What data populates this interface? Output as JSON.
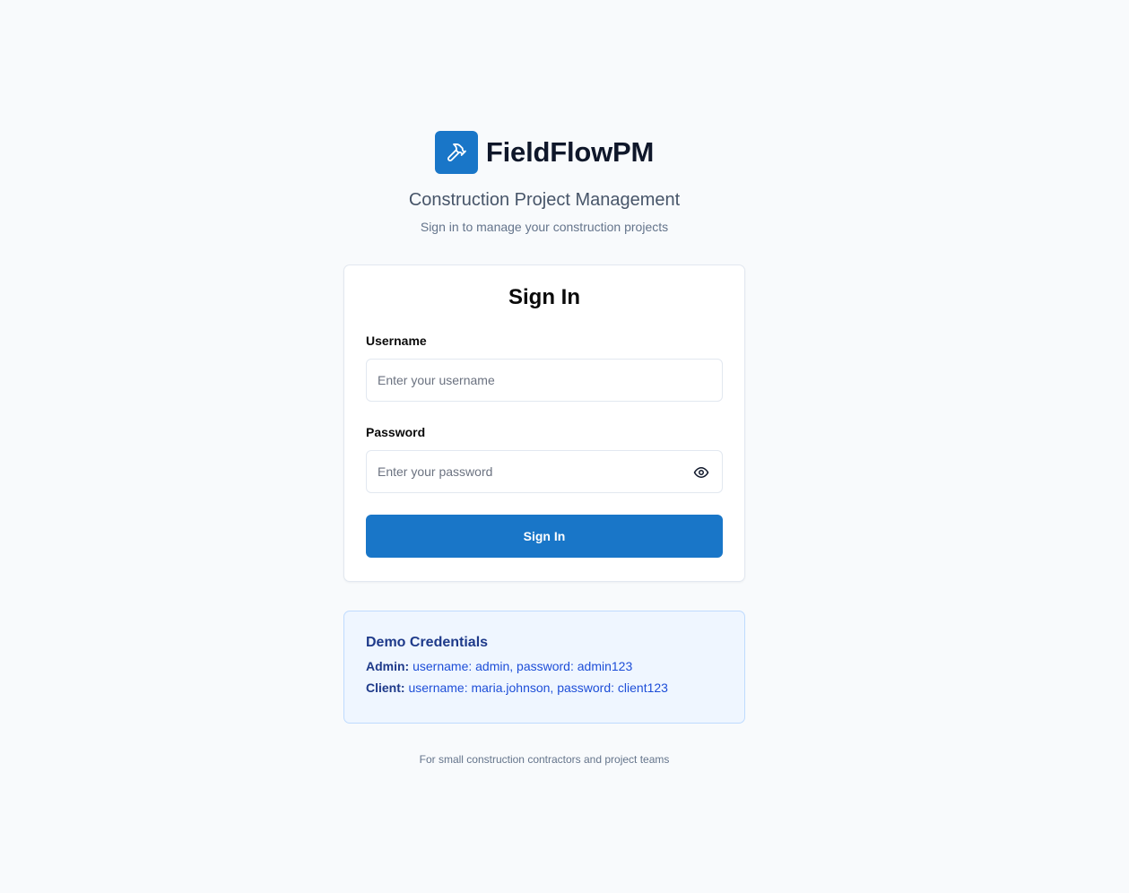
{
  "brand": {
    "name": "FieldFlowPM",
    "logo_icon": "hammer-icon",
    "accent_color": "#1976c8",
    "tagline": "Construction Project Management",
    "subtagline": "Sign in to manage your construction projects"
  },
  "signin": {
    "title": "Sign In",
    "username_label": "Username",
    "username_placeholder": "Enter your username",
    "username_value": "",
    "password_label": "Password",
    "password_placeholder": "Enter your password",
    "password_value": "",
    "password_toggle_icon": "eye-icon",
    "submit_label": "Sign In"
  },
  "demo": {
    "title": "Demo Credentials",
    "admin_label": "Admin:",
    "admin_text": "username: admin, password: admin123",
    "client_label": "Client:",
    "client_text": "username: maria.johnson, password: client123"
  },
  "footer": {
    "text": "For small construction contractors and project teams"
  }
}
